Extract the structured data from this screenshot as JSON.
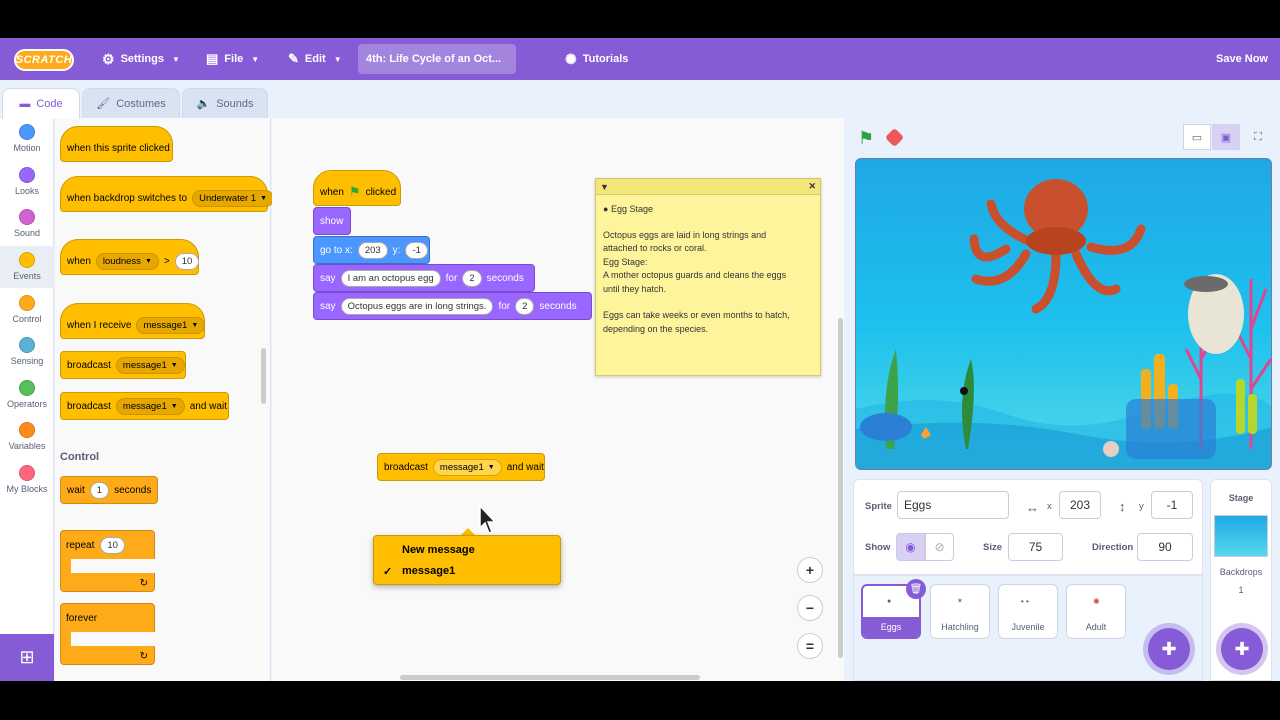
{
  "menubar": {
    "logo": "SCRATCH",
    "settings": "Settings",
    "file": "File",
    "edit": "Edit",
    "project_title": "4th: Life Cycle of an Oct...",
    "tutorials": "Tutorials",
    "save_now": "Save Now"
  },
  "tabs": {
    "code": "Code",
    "costumes": "Costumes",
    "sounds": "Sounds"
  },
  "categories": [
    {
      "label": "Motion",
      "color": "#4c97ff"
    },
    {
      "label": "Looks",
      "color": "#9966ff"
    },
    {
      "label": "Sound",
      "color": "#cf63cf"
    },
    {
      "label": "Events",
      "color": "#ffbf00"
    },
    {
      "label": "Control",
      "color": "#ffab19"
    },
    {
      "label": "Sensing",
      "color": "#5cb1d6"
    },
    {
      "label": "Operators",
      "color": "#59c059"
    },
    {
      "label": "Variables",
      "color": "#ff8c1a"
    },
    {
      "label": "My Blocks",
      "color": "#ff6680"
    }
  ],
  "palette": {
    "when_sprite_clicked": "when this sprite clicked",
    "when_backdrop": "when backdrop switches to",
    "backdrop_value": "Underwater 1",
    "when": "when",
    "loudness": "loudness",
    "gt": ">",
    "loud_value": "10",
    "when_receive": "when I receive",
    "msg": "message1",
    "broadcast": "broadcast",
    "and_wait": "and wait",
    "control_header": "Control",
    "wait": "wait",
    "wait_value": "1",
    "seconds": "seconds",
    "repeat": "repeat",
    "repeat_value": "10",
    "forever": "forever",
    "loop_arrow": "↻"
  },
  "script": {
    "when": "when",
    "clicked": "clicked",
    "show": "show",
    "goto": "go to x:",
    "x_val": "203",
    "y_label": "y:",
    "y_val": "-1",
    "say": "say",
    "say1_text": "I am an octopus egg",
    "for": "for",
    "secs1": "2",
    "seconds": "seconds",
    "say2_text": "Octopus eggs are in long strings.",
    "secs2": "2",
    "broadcast": "broadcast",
    "broadcast_msg": "message1",
    "and_wait": "and wait"
  },
  "dropdown": {
    "new_message": "New message",
    "check": "✓",
    "message1": "message1"
  },
  "note": {
    "title": "Egg Stage",
    "lines": [
      "Octopus eggs are laid in long strings and",
      "attached to rocks or coral.",
      "Egg Stage:",
      "A mother octopus guards and cleans the eggs",
      "until they hatch.",
      "",
      "Eggs can take weeks or even months to hatch,",
      "depending on the species."
    ]
  },
  "zoom": {
    "in": "+",
    "out": "−",
    "reset": "="
  },
  "sprite_info": {
    "sprite_label": "Sprite",
    "sprite_name": "Eggs",
    "x_label": "x",
    "x": "203",
    "y_label": "y",
    "y": "-1",
    "show_label": "Show",
    "size_label": "Size",
    "size": "75",
    "direction_label": "Direction",
    "direction": "90"
  },
  "sprites": [
    {
      "name": "Eggs"
    },
    {
      "name": "Hatchling"
    },
    {
      "name": "Juvenile"
    },
    {
      "name": "Adult"
    }
  ],
  "stage_pane": {
    "title": "Stage",
    "backdrops_label": "Backdrops",
    "backdrops_count": "1"
  }
}
